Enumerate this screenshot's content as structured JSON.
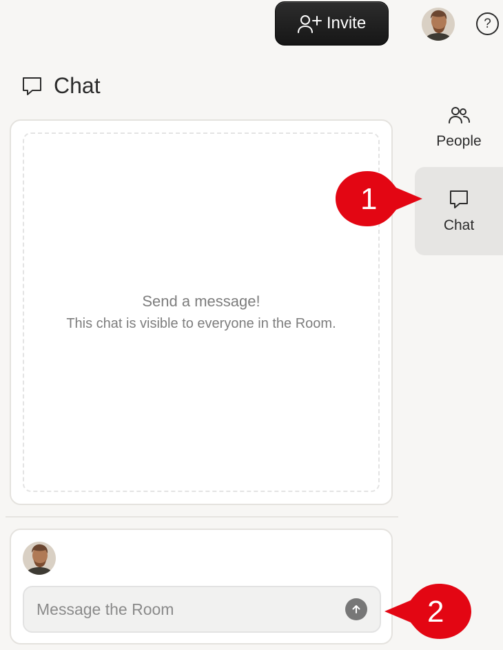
{
  "header": {
    "invite_label": "Invite",
    "help_label": "?"
  },
  "chat_heading": {
    "title": "Chat"
  },
  "sidebar": {
    "tabs": [
      {
        "label": "People",
        "icon": "people-icon",
        "active": false
      },
      {
        "label": "Chat",
        "icon": "chat-bubble-icon",
        "active": true
      }
    ]
  },
  "messages": {
    "empty_title": "Send a message!",
    "empty_subtitle": "This chat is visible to everyone in the Room."
  },
  "composer": {
    "placeholder": "Message the Room",
    "value": ""
  },
  "annotations": {
    "callout_1": "1",
    "callout_2": "2",
    "color": "#e30613"
  },
  "colors": {
    "background": "#f7f6f4",
    "invite_button": "#1e1e1e",
    "active_tab": "#e6e5e3",
    "send_button": "#777777"
  }
}
